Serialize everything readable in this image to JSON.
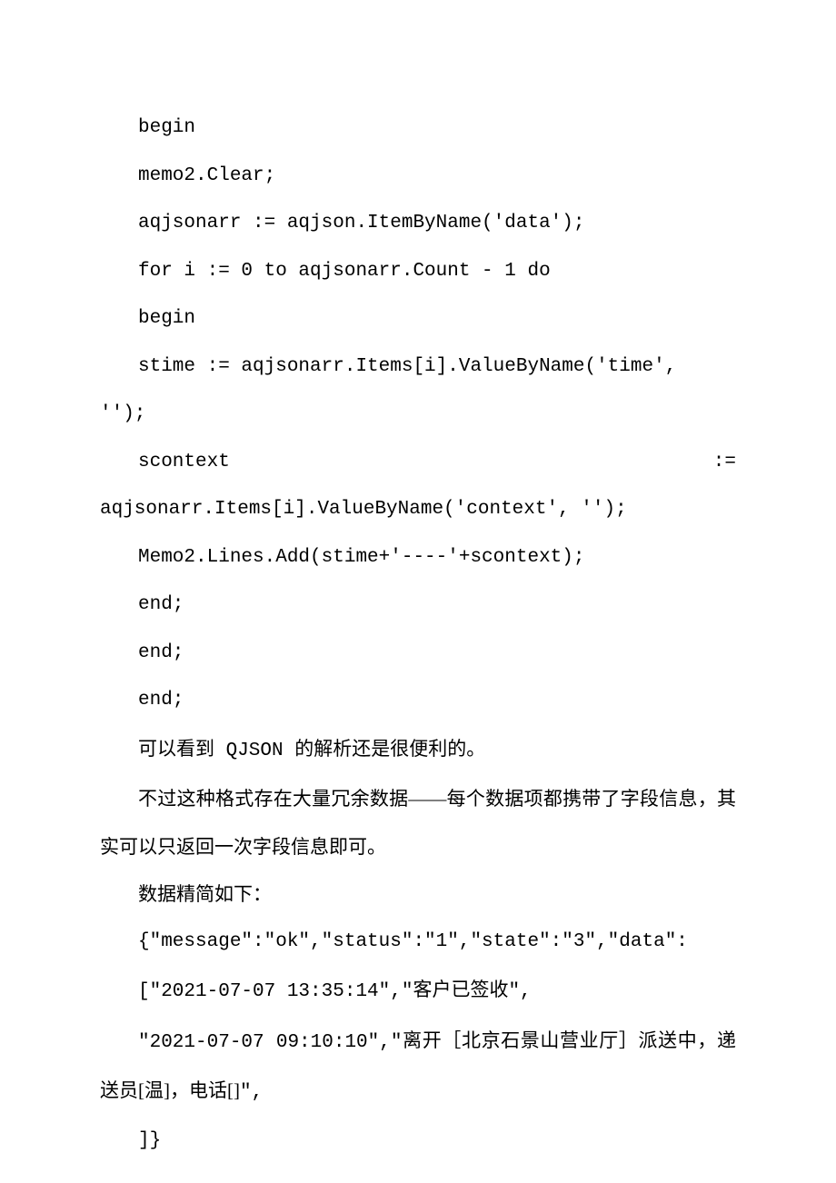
{
  "lines": {
    "l1": "begin",
    "l2": "memo2.Clear;",
    "l3": "aqjsonarr := aqjson.ItemByName('data');",
    "l4": "for i := 0 to aqjsonarr.Count - 1 do",
    "l5": "begin",
    "l6a": "stime  :=  aqjsonarr.Items[i].ValueByName('time',",
    "l6b": "'');",
    "l7a": "scontext",
    "l7b": ":=",
    "l7c": "aqjsonarr.Items[i].ValueByName('context', '');",
    "l8": "Memo2.Lines.Add(stime+'----'+scontext);",
    "l9": "end;",
    "l10": "end;",
    "l11": "end;",
    "l12a": "可以看到",
    "l12b": " QJSON ",
    "l12c": "的解析还是很便利的。",
    "l13": "不过这种格式存在大量冗余数据——每个数据项都携带了字段信息，其实可以只返回一次字段信息即可。",
    "l14": "数据精简如下：",
    "l15": "{\"message\":\"ok\",\"status\":\"1\",\"state\":\"3\",\"data\":",
    "l16a": "[\"2021-07-07 13:35:14\",\"",
    "l16b": "客户已签收",
    "l16c": "\",",
    "l17a": "\"2021-07-07 09:10:10\",\"",
    "l17b": "离开［北京石景山营业厅］派送中，递送员[温]，电话[]",
    "l17c": "\",",
    "l18": "]}"
  }
}
